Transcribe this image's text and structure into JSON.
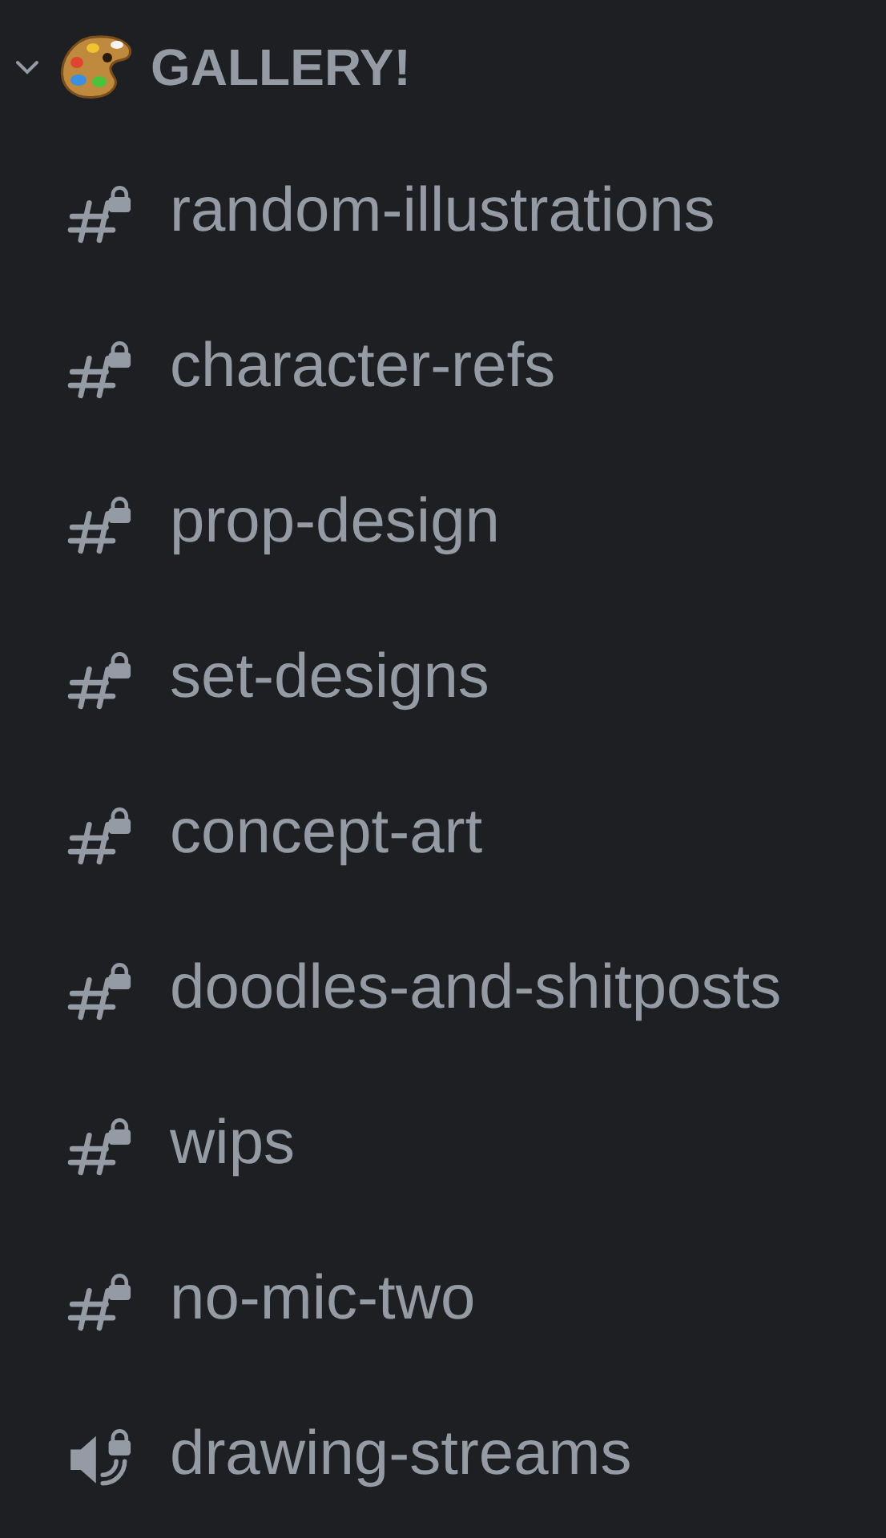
{
  "category": {
    "name": "GALLERY!",
    "expanded": true
  },
  "channels": [
    {
      "name": "random-illustrations",
      "kind": "text",
      "locked": true
    },
    {
      "name": "character-refs",
      "kind": "text",
      "locked": true
    },
    {
      "name": "prop-design",
      "kind": "text",
      "locked": true
    },
    {
      "name": "set-designs",
      "kind": "text",
      "locked": true
    },
    {
      "name": "concept-art",
      "kind": "text",
      "locked": true
    },
    {
      "name": "doodles-and-shitposts",
      "kind": "text",
      "locked": true
    },
    {
      "name": "wips",
      "kind": "text",
      "locked": true
    },
    {
      "name": "no-mic-two",
      "kind": "text",
      "locked": true
    },
    {
      "name": "drawing-streams",
      "kind": "voice",
      "locked": true
    }
  ]
}
